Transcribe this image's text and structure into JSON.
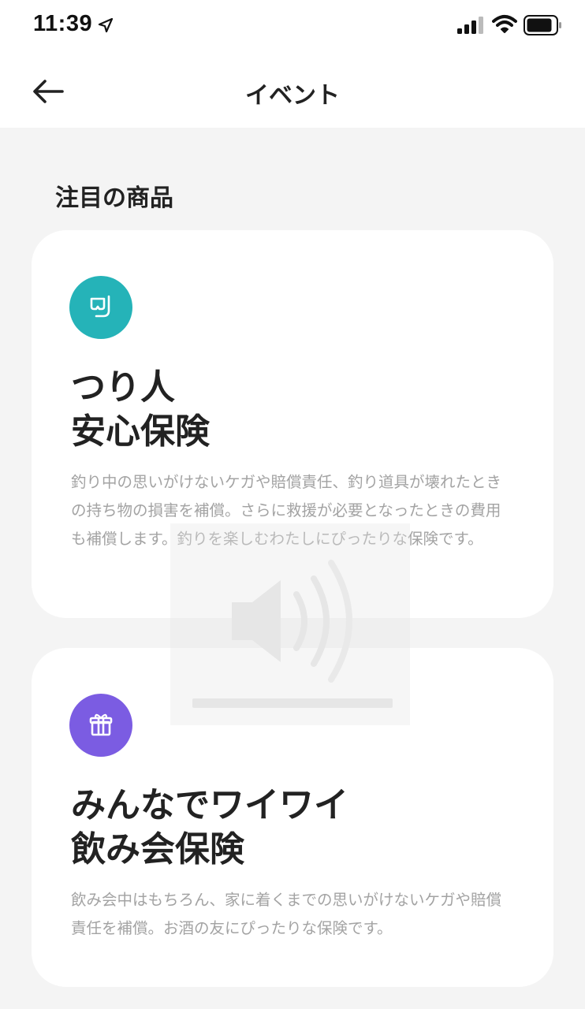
{
  "status_bar": {
    "time": "11:39",
    "icons": [
      "location-arrow-icon",
      "cellular-signal-icon",
      "wifi-icon",
      "battery-icon"
    ]
  },
  "nav": {
    "back_icon": "arrow-left-icon",
    "title": "イベント"
  },
  "section": {
    "title": "注目の商品"
  },
  "products": [
    {
      "icon": "snorkel-mask-icon",
      "icon_color": "#25b3b8",
      "title_line1": "つり人",
      "title_line2": "安心保険",
      "description": "釣り中の思いがけないケガや賠償責任、釣り道具が壊れたときの持ち物の損害を補償。さらに救援が必要となったときの費用も補償します。釣りを楽しむわたしにぴったりな保険です。"
    },
    {
      "icon": "gift-box-icon",
      "icon_color": "#7b5ce2",
      "title_line1": "みんなでワイワイ",
      "title_line2": "飲み会保険",
      "description": "飲み会中はもちろん、家に着くまでの思いがけないケガや賠償責任を補償。お酒の友にぴったりな保険です。"
    }
  ],
  "colors": {
    "background": "#f4f4f4",
    "card": "#ffffff",
    "text_primary": "#222222",
    "text_secondary": "#a3a3a3"
  }
}
